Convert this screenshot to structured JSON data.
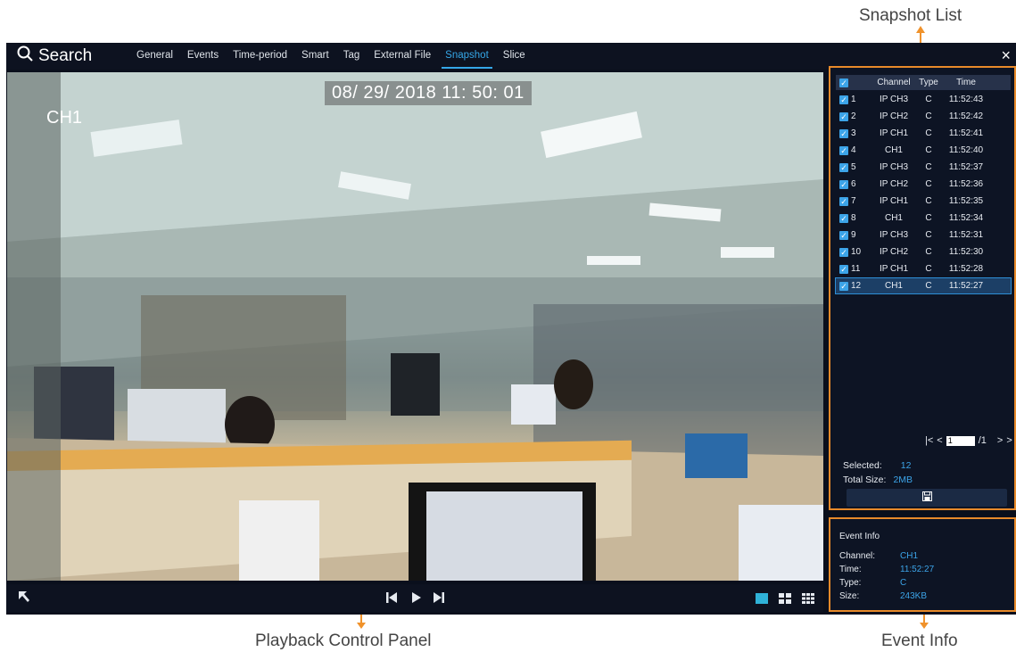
{
  "callouts": {
    "snapshot_list": "Snapshot List",
    "playback_panel": "Playback Control Panel",
    "event_info": "Event Info"
  },
  "header": {
    "title": "Search",
    "tabs": [
      {
        "label": "General",
        "active": false
      },
      {
        "label": "Events",
        "active": false
      },
      {
        "label": "Time-period",
        "active": false
      },
      {
        "label": "Smart",
        "active": false
      },
      {
        "label": "Tag",
        "active": false
      },
      {
        "label": "External File",
        "active": false
      },
      {
        "label": "Snapshot",
        "active": true
      },
      {
        "label": "Slice",
        "active": false
      }
    ],
    "close": "×"
  },
  "video": {
    "timestamp": "08/ 29/ 2018  11: 50: 01",
    "channel": "CH1"
  },
  "snapshot_table": {
    "headers": {
      "channel": "Channel",
      "type": "Type",
      "time": "Time"
    },
    "rows": [
      {
        "no": "1",
        "channel": "IP CH3",
        "type": "C",
        "time": "11:52:43"
      },
      {
        "no": "2",
        "channel": "IP CH2",
        "type": "C",
        "time": "11:52:42"
      },
      {
        "no": "3",
        "channel": "IP CH1",
        "type": "C",
        "time": "11:52:41"
      },
      {
        "no": "4",
        "channel": "CH1",
        "type": "C",
        "time": "11:52:40"
      },
      {
        "no": "5",
        "channel": "IP CH3",
        "type": "C",
        "time": "11:52:37"
      },
      {
        "no": "6",
        "channel": "IP CH2",
        "type": "C",
        "time": "11:52:36"
      },
      {
        "no": "7",
        "channel": "IP CH1",
        "type": "C",
        "time": "11:52:35"
      },
      {
        "no": "8",
        "channel": "CH1",
        "type": "C",
        "time": "11:52:34"
      },
      {
        "no": "9",
        "channel": "IP CH3",
        "type": "C",
        "time": "11:52:31"
      },
      {
        "no": "10",
        "channel": "IP CH2",
        "type": "C",
        "time": "11:52:30"
      },
      {
        "no": "11",
        "channel": "IP CH1",
        "type": "C",
        "time": "11:52:28"
      },
      {
        "no": "12",
        "channel": "CH1",
        "type": "C",
        "time": "11:52:27"
      }
    ],
    "selected_row": "12"
  },
  "pager": {
    "current": "1",
    "total": "/1"
  },
  "selection": {
    "selected_label": "Selected:",
    "selected_value": "12",
    "size_label": "Total Size:",
    "size_value": "2MB"
  },
  "event_info": {
    "title": "Event Info",
    "channel_label": "Channel:",
    "channel": "CH1",
    "time_label": "Time:",
    "time": "11:52:27",
    "type_label": "Type:",
    "type": "C",
    "size_label": "Size:",
    "size": "243KB"
  },
  "colors": {
    "accent": "#35a7e8",
    "highlight_border": "#e88a2a",
    "panel_bg": "#0d1424"
  }
}
